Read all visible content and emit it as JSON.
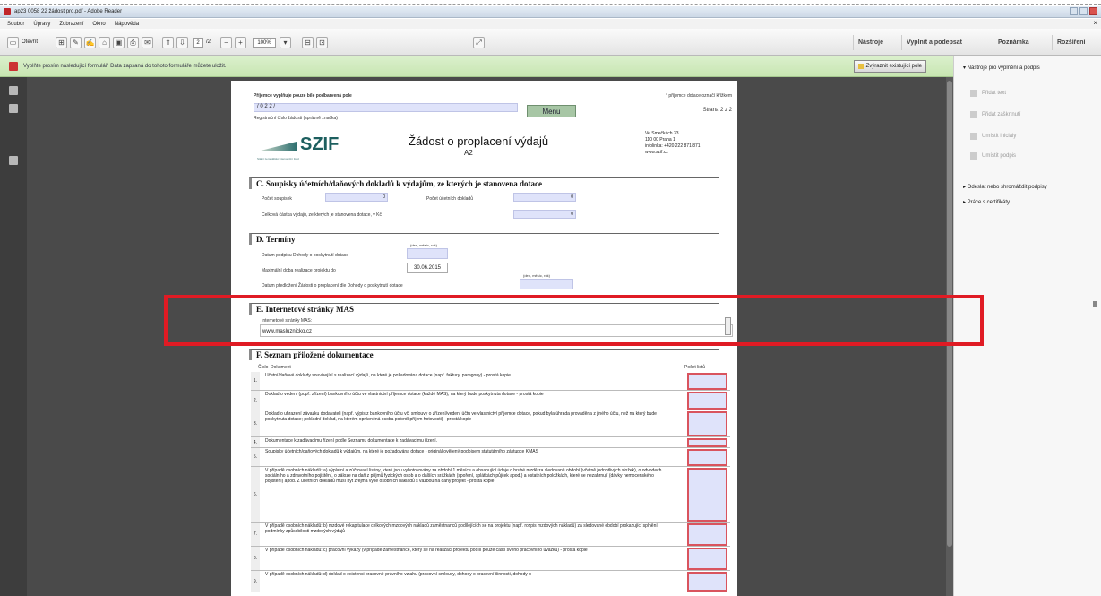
{
  "window": {
    "title": "ap23 0058 22 žádost pro.pdf - Adobe Reader"
  },
  "menu": {
    "items": [
      "Soubor",
      "Úpravy",
      "Zobrazení",
      "Okno",
      "Nápověda"
    ]
  },
  "toolbar": {
    "open_label": "Otevřít",
    "page_current": "2",
    "page_total": "/2",
    "zoom": "100%",
    "tools_label": "Nástroje",
    "sign_label": "Vyplnit a podepsat",
    "comment_label": "Poznámka",
    "extended_label": "Rozšíření"
  },
  "notify": {
    "text": "Vyplňte prosím následující formulář. Data zapsaná do tohoto formuláře můžete uložit.",
    "highlight_label": "Zvýraznit existující pole"
  },
  "rightpane": {
    "section1": "▾ Nástroje pro vyplnění a podpis",
    "items": [
      "Přidat text",
      "Přidat zaškrtnutí",
      "Umístit iniciály",
      "Umístit podpis"
    ],
    "section2": "▸ Odeslat nebo shromáždit podpisy",
    "section3": "▸ Práce s certifikáty"
  },
  "form": {
    "header_note": "Příjemce vyplňuje pouze bíle podbarvená pole",
    "reg_label": "Registrační číslo žádosti (správně značka)",
    "reg_prefix": "/ 0 2 2 /",
    "required_note": "* příjemce dotace označí křížkem",
    "page_info": "Strana 2 z 2",
    "menu_button": "Menu",
    "logo_text": "SZIF",
    "logo_sub": "Státní zemědělský intervenční fond",
    "title": "Žádost o proplacení výdajů",
    "subtitle": "A2",
    "address": [
      "Ve Smečkách 33",
      "110 00 Praha 1",
      "infolinka: +420 222 871 871",
      "www.szif.cz"
    ],
    "sectionC": {
      "title": "C. Soupisky účetních/daňových dokladů k výdajům, ze kterých je stanovena dotace",
      "count_label": "Počet soupisek",
      "count_value": "0",
      "docs_label": "Počet účetních dokladů",
      "docs_value": "0",
      "total_label": "Celková částka výdajů, ze kterých je stanovena dotace, v Kč",
      "total_value": "0"
    },
    "sectionD": {
      "title": "D. Termíny",
      "fmt": "(den, měsíc, rok)",
      "sign_label": "Datum podpisu Dohody o poskytnutí dotace",
      "max_label": "Maximální doba realizace projektu do",
      "max_value": "30.06.2015",
      "submit_label": "Datum předložení Žádosti o proplacení dle Dohody o poskytnutí dotace"
    },
    "sectionE": {
      "title": "E. Internetové stránky MAS",
      "label": "Internetové stránky MAS:",
      "value": "www.masluznicko.cz"
    },
    "sectionF": {
      "title": "F. Seznam přiložené dokumentace",
      "col_no": "Číslo",
      "col_doc": "Dokument",
      "col_count": "Počet listů",
      "rows": [
        {
          "no": "1.",
          "text": "Účetní/daňové doklady související s realizací výdajů, na které je požadována dotace (např. faktury, paragony) - prostá kopie"
        },
        {
          "no": "2.",
          "text": "Doklad o vedení (popř. zřízení) bankovního účtu ve vlastnictví příjemce dotace (každé MAS), na který bude poskytnuta dotace - prostá kopie"
        },
        {
          "no": "3.",
          "text": "Doklad o uhrazení závazku dodavateli (např. výpis z bankovního účtu vč. smlouvy o zřízení/vedení účtu ve vlastnictví příjemce dotace, pokud byla úhrada prováděna z jiného účtu, než na který bude poskytnuta dotace; pokladní doklad, na kterém oprávněná osoba potvrdí příjem hotovosti) - prostá kopie"
        },
        {
          "no": "4.",
          "text": "Dokumentace k zadávacímu řízení podle Seznamu dokumentace k zadávacímu řízení."
        },
        {
          "no": "5.",
          "text": "Soupisky účetních/daňových dokladů k výdajům, na které je požadována dotace - originál ověřený podpisem statutárního zástupce KMAS"
        },
        {
          "no": "6.",
          "text": "V případě osobních nákladů: a) výplatní a zúčtovací listiny, které jsou vyhotovovány za období 1 měsíce a obsahující údaje o hrubé mzdě za sledované období (včetně jednotlivých složek), o odvodech sociálního a zdravotního pojištění, o záloze na daň z příjmů fyzických osob a o dalších srážkách (spoření, splátkách půjček apod.) a ostatních položkách, které se nezahrnují (dávky nemocenského pojištění) apod. Z účetních dokladů musí být zřejmá výše osobních nákladů s vazbou na daný projekt - prostá kopie"
        },
        {
          "no": "7.",
          "text": "V případě osobních nákladů: b) mzdové rekapitulace celkových mzdových nákladů zaměstnanců podílejících se na projektu (např. rozpis mzdových nákladů) za sledované období prokazující splnění podmínky způsobilosti mzdových výdajů"
        },
        {
          "no": "8.",
          "text": "V případě osobních nákladů: c) pracovní výkazy (v případě zaměstnance, který se na realizaci projektu podílí pouze částí svého pracovního úvazku) - prostá kopie"
        },
        {
          "no": "9.",
          "text": "V případě osobních nákladů: d) doklad o existenci pracovně-právního vztahu (pracovní smlouvy, dohody o pracovní činnosti, dohody o"
        }
      ]
    }
  }
}
